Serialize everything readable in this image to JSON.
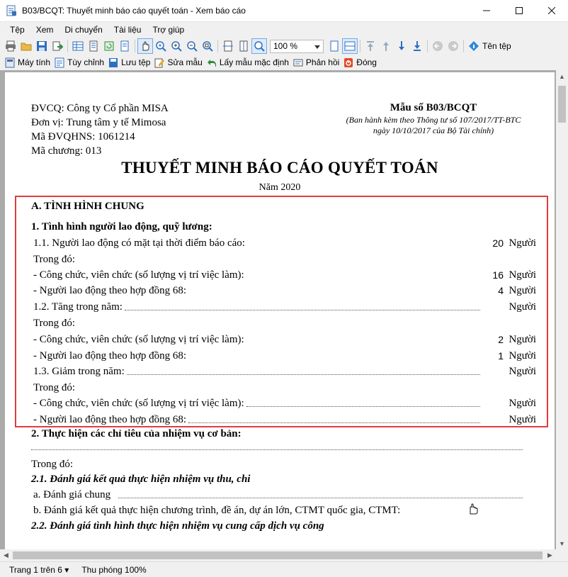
{
  "window": {
    "title": "B03/BCQT: Thuyết minh báo cáo quyết toán - Xem báo cáo"
  },
  "menu": [
    "Tệp",
    "Xem",
    "Di chuyển",
    "Tài liệu",
    "Trợ giúp"
  ],
  "toolbar1": {
    "zoom_value": "100 %",
    "file_name_label": "Tên tệp"
  },
  "toolbar2": {
    "calculator": "Máy tính",
    "customize": "Tùy chỉnh",
    "save_file": "Lưu tệp",
    "edit_template": "Sửa mẫu",
    "default_template": "Lấy mẫu mặc định",
    "feedback": "Phản hồi",
    "close": "Đóng"
  },
  "document": {
    "header_left": {
      "agency": "ĐVCQ: Công ty Cổ phần MISA",
      "unit": "Đơn vị: Trung tâm y tế Mimosa",
      "code": "Mã ĐVQHNS: 1061214",
      "chapter": "Mã chương: 013"
    },
    "header_right": {
      "form_no": "Mẫu số B03/BCQT",
      "note_line1": "(Ban hành kèm theo Thông tư số 107/2017/TT-BTC",
      "note_line2": "ngày 10/10/2017 của Bộ Tài chính)"
    },
    "title": "THUYẾT MINH BÁO CÁO QUYẾT TOÁN",
    "year": "Năm 2020",
    "section_a": "A. TÌNH HÌNH CHUNG",
    "sub1": "1. Tình hình người lao động, quỹ lương:",
    "rows": [
      {
        "label": "1.1. Người lao động có mặt tại thời điểm báo cáo:",
        "value": "20",
        "unit": "Người"
      },
      {
        "label": "Trong đó:"
      },
      {
        "label": "- Công chức, viên chức (số lượng vị trí việc làm):",
        "value": "16",
        "unit": "Người"
      },
      {
        "label": "- Người lao động theo hợp đồng 68:",
        "value": "4",
        "unit": "Người"
      },
      {
        "label": "1.2. Tăng trong năm:",
        "value": "",
        "unit": "Người"
      },
      {
        "label": "Trong đó:"
      },
      {
        "label": "- Công chức, viên chức (số lượng vị trí việc làm):",
        "value": "2",
        "unit": "Người"
      },
      {
        "label": "- Người lao động theo hợp đồng 68:",
        "value": "1",
        "unit": "Người"
      },
      {
        "label": "1.3. Giảm trong năm:",
        "value": "",
        "unit": "Người"
      },
      {
        "label": "Trong đó:"
      },
      {
        "label": "- Công chức, viên chức (số lượng vị trí việc làm):",
        "value": "",
        "unit": "Người"
      },
      {
        "label": "- Người lao động theo hợp đồng 68:",
        "value": "",
        "unit": "Người"
      }
    ],
    "sub2": "2. Thực hiện các chỉ tiêu của nhiệm vụ cơ bản:",
    "trong_do": "Trong đó:",
    "sub21": "2.1. Đánh giá kết quả thực hiện nhiệm vụ thu, chi",
    "item_a": "a. Đánh giá chung",
    "item_b": "b. Đánh giá kết quả thực hiện chương trình, đề án, dự án lớn, CTMT quốc gia, CTMT:",
    "sub22": "2.2. Đánh giá tình hình thực hiện nhiệm vụ cung cấp dịch vụ công"
  },
  "status": {
    "page": "Trang 1 trên 6",
    "zoom": "Thu phóng 100%"
  },
  "colors": {
    "highlight_box": "#e03c3c",
    "toolbar_active": "#dcebfc"
  }
}
